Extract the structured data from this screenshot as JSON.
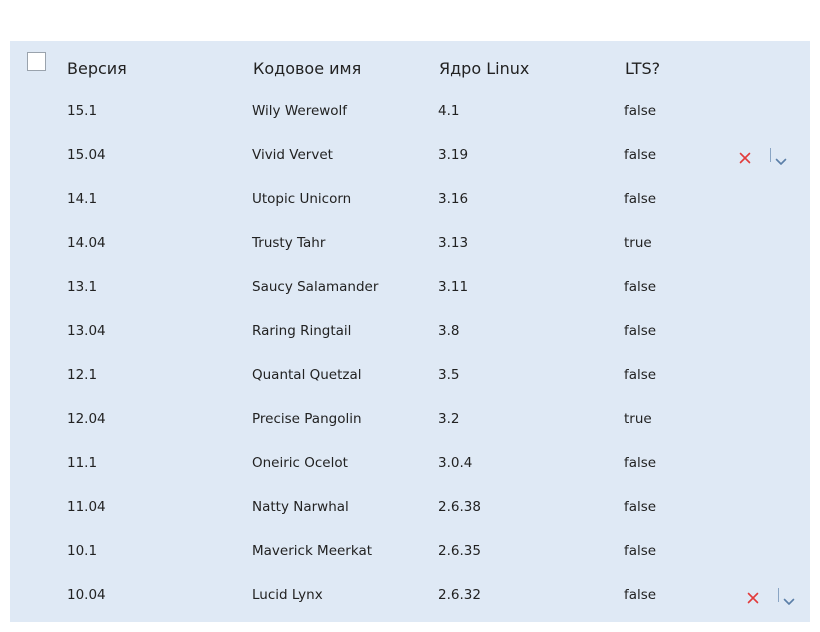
{
  "table": {
    "headers": {
      "select_all_checked": false,
      "version": "Версия",
      "codename": "Кодовое имя",
      "kernel": "Ядро Linux",
      "lts": "LTS?"
    },
    "rows": [
      {
        "version": "15.1",
        "codename": "Wily Werewolf",
        "kernel": "4.1",
        "lts": "false",
        "show_actions": false
      },
      {
        "version": "15.04",
        "codename": "Vivid Vervet",
        "kernel": "3.19",
        "lts": "false",
        "show_actions": true
      },
      {
        "version": "14.1",
        "codename": "Utopic Unicorn",
        "kernel": "3.16",
        "lts": "false",
        "show_actions": false
      },
      {
        "version": "14.04",
        "codename": "Trusty Tahr",
        "kernel": "3.13",
        "lts": "true",
        "show_actions": false
      },
      {
        "version": "13.1",
        "codename": "Saucy Salamander",
        "kernel": "3.11",
        "lts": "false",
        "show_actions": false
      },
      {
        "version": "13.04",
        "codename": "Raring Ringtail",
        "kernel": "3.8",
        "lts": "false",
        "show_actions": false
      },
      {
        "version": "12.1",
        "codename": "Quantal Quetzal",
        "kernel": "3.5",
        "lts": "false",
        "show_actions": false
      },
      {
        "version": "12.04",
        "codename": "Precise Pangolin",
        "kernel": "3.2",
        "lts": "true",
        "show_actions": false
      },
      {
        "version": "11.1",
        "codename": "Oneiric Ocelot",
        "kernel": "3.0.4",
        "lts": "false",
        "show_actions": false
      },
      {
        "version": "11.04",
        "codename": "Natty Narwhal",
        "kernel": "2.6.38",
        "lts": "false",
        "show_actions": false
      },
      {
        "version": "10.1",
        "codename": "Maverick Meerkat",
        "kernel": "2.6.35",
        "lts": "false",
        "show_actions": false
      },
      {
        "version": "10.04",
        "codename": "Lucid Lynx",
        "kernel": "2.6.32",
        "lts": "false",
        "show_actions": true
      }
    ],
    "icons": {
      "delete": "close-icon",
      "menu": "chevron-down-icon"
    }
  },
  "colors": {
    "table_background": "#dfe9f5",
    "delete_icon": "#e23b3b",
    "menu_icon": "#5b7fa8",
    "text": "#222222"
  }
}
